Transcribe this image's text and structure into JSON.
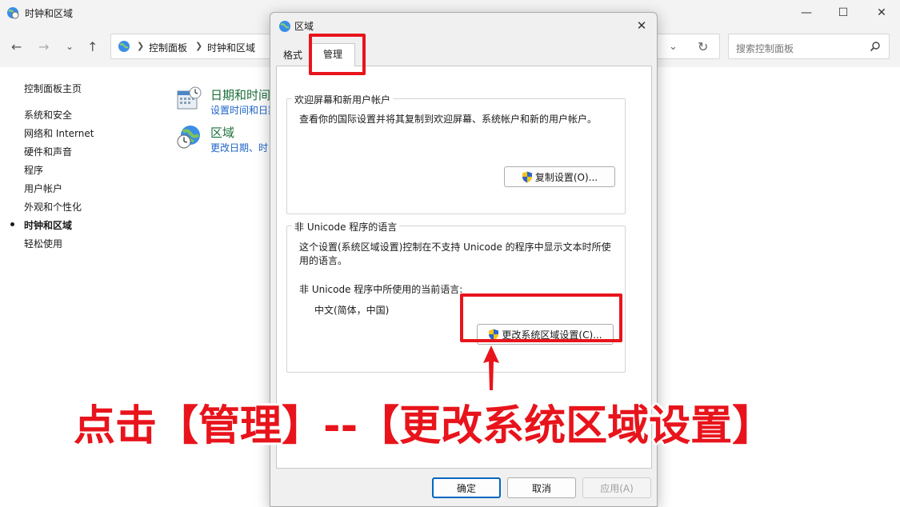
{
  "background_window": {
    "title": "时钟和区域",
    "breadcrumb": [
      "控制面板",
      "时钟和区域"
    ],
    "search_placeholder": "搜索控制面板",
    "sidebar": {
      "home": "控制面板主页",
      "items": [
        "系统和安全",
        "网络和 Internet",
        "硬件和声音",
        "程序",
        "用户帐户",
        "外观和个性化",
        "时钟和区域",
        "轻松使用"
      ],
      "active": "时钟和区域"
    },
    "categories": [
      {
        "title": "日期和时间",
        "subtitle": "设置时间和日期",
        "icon": "calendar-clock-icon"
      },
      {
        "title": "区域",
        "subtitle": "更改日期、时",
        "icon": "globe-clock-icon"
      }
    ]
  },
  "dialog": {
    "title": "区域",
    "tabs": [
      {
        "label": "格式",
        "selected": false
      },
      {
        "label": "管理",
        "selected": true
      }
    ],
    "welcome_group": {
      "legend": "欢迎屏幕和新用户帐户",
      "description": "查看你的国际设置并将其复制到欢迎屏幕、系统帐户和新的用户帐户。",
      "button": "复制设置(O)..."
    },
    "unicode_group": {
      "legend": "非 Unicode 程序的语言",
      "description_line1": "这个设置(系统区域设置)控制在不支持 Unicode 的程序中显示文本时所使",
      "description_line2": "用的语言。",
      "current_label": "非 Unicode 程序中所使用的当前语言:",
      "current_value": "中文(简体，中国)",
      "button": "更改系统区域设置(C)..."
    },
    "buttons": {
      "ok": "确定",
      "cancel": "取消",
      "apply": "应用(A)"
    }
  },
  "annotation": {
    "text": "点击【管理】--【更改系统区域设置】",
    "color": "#e8141c"
  }
}
